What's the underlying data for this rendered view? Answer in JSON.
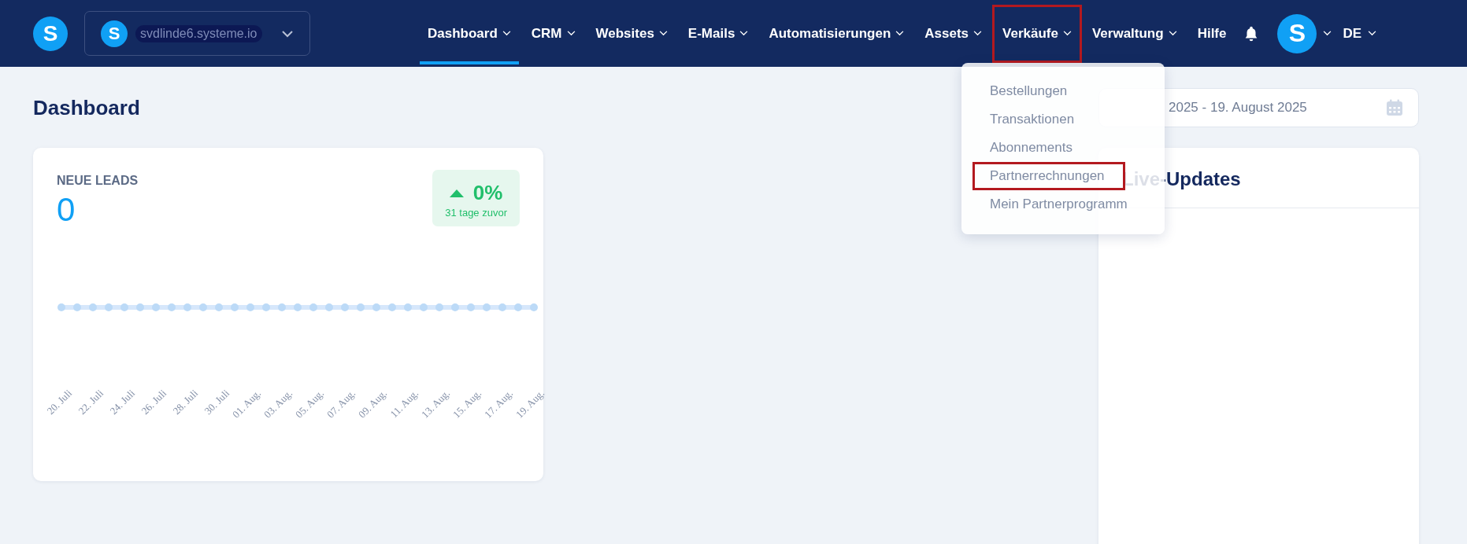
{
  "header": {
    "logo": "S",
    "workspace": {
      "icon": "S",
      "domain": "svdlinde6.systeme.io"
    },
    "nav": [
      {
        "label": "Dashboard",
        "kind": "menu",
        "selected": true,
        "highlighted": false
      },
      {
        "label": "CRM",
        "kind": "menu",
        "selected": false,
        "highlighted": false
      },
      {
        "label": "Websites",
        "kind": "menu",
        "selected": false,
        "highlighted": false
      },
      {
        "label": "E-Mails",
        "kind": "menu",
        "selected": false,
        "highlighted": false
      },
      {
        "label": "Automatisierungen",
        "kind": "menu",
        "selected": false,
        "highlighted": false
      },
      {
        "label": "Assets",
        "kind": "menu",
        "selected": false,
        "highlighted": false
      },
      {
        "label": "Verkäufe",
        "kind": "menu",
        "selected": false,
        "highlighted": true
      },
      {
        "label": "Verwaltung",
        "kind": "menu",
        "selected": false,
        "highlighted": false
      },
      {
        "label": "Hilfe",
        "kind": "link",
        "selected": false,
        "highlighted": false
      }
    ],
    "avatar": "S",
    "language": "DE"
  },
  "dropdown": [
    {
      "label": "Bestellungen",
      "highlighted": false
    },
    {
      "label": "Transaktionen",
      "highlighted": false
    },
    {
      "label": "Abonnements",
      "highlighted": false
    },
    {
      "label": "Partnerrechnungen",
      "highlighted": true
    },
    {
      "label": "Mein Partnerprogramm",
      "highlighted": false
    }
  ],
  "page_title": "Dashboard",
  "date_range": "2025 - 19. August 2025",
  "leads_card": {
    "title": "NEUE LEADS",
    "value": "0",
    "change": "0%",
    "change_caption": "31 tage zuvor",
    "x_labels": [
      "20. Juli",
      "22. Juli",
      "24. Juli",
      "26. Juli",
      "28. Juli",
      "30. Juli",
      "01. Aug.",
      "03. Aug.",
      "05. Aug.",
      "07. Aug.",
      "09. Aug.",
      "11. Aug.",
      "13. Aug.",
      "15. Aug.",
      "17. Aug.",
      "19. Aug."
    ]
  },
  "live_updates": {
    "title": "Live-Updates"
  }
}
